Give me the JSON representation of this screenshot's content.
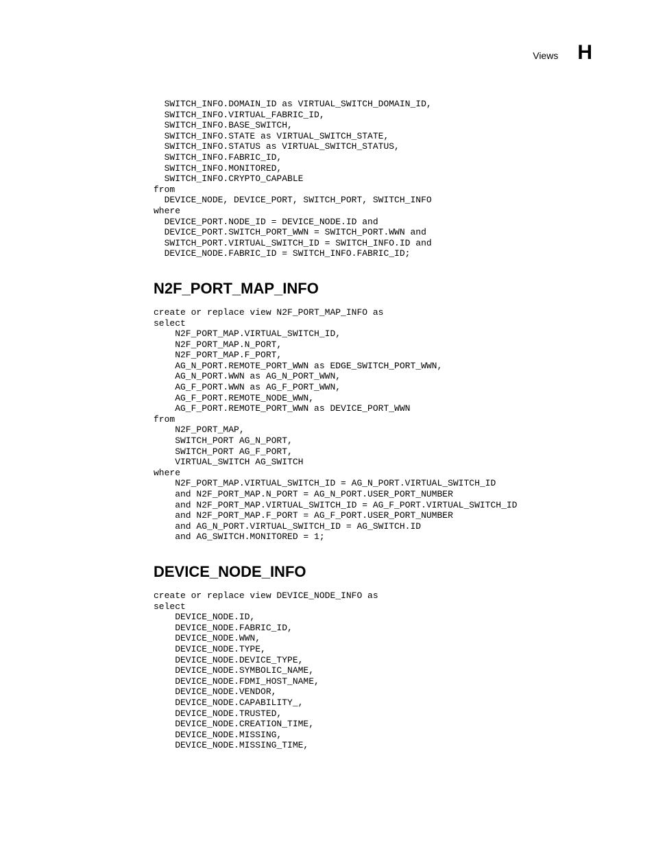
{
  "header": {
    "label": "Views",
    "letter": "H"
  },
  "code_block_1": "  SWITCH_INFO.DOMAIN_ID as VIRTUAL_SWITCH_DOMAIN_ID,\n  SWITCH_INFO.VIRTUAL_FABRIC_ID,\n  SWITCH_INFO.BASE_SWITCH,\n  SWITCH_INFO.STATE as VIRTUAL_SWITCH_STATE,\n  SWITCH_INFO.STATUS as VIRTUAL_SWITCH_STATUS,\n  SWITCH_INFO.FABRIC_ID,\n  SWITCH_INFO.MONITORED,\n  SWITCH_INFO.CRYPTO_CAPABLE\nfrom\n  DEVICE_NODE, DEVICE_PORT, SWITCH_PORT, SWITCH_INFO\nwhere\n  DEVICE_PORT.NODE_ID = DEVICE_NODE.ID and\n  DEVICE_PORT.SWITCH_PORT_WWN = SWITCH_PORT.WWN and\n  SWITCH_PORT.VIRTUAL_SWITCH_ID = SWITCH_INFO.ID and\n  DEVICE_NODE.FABRIC_ID = SWITCH_INFO.FABRIC_ID;",
  "heading_1": "N2F_PORT_MAP_INFO",
  "code_block_2": "create or replace view N2F_PORT_MAP_INFO as\nselect\n    N2F_PORT_MAP.VIRTUAL_SWITCH_ID,\n    N2F_PORT_MAP.N_PORT,\n    N2F_PORT_MAP.F_PORT,\n    AG_N_PORT.REMOTE_PORT_WWN as EDGE_SWITCH_PORT_WWN,\n    AG_N_PORT.WWN as AG_N_PORT_WWN,\n    AG_F_PORT.WWN as AG_F_PORT_WWN,\n    AG_F_PORT.REMOTE_NODE_WWN,\n    AG_F_PORT.REMOTE_PORT_WWN as DEVICE_PORT_WWN\nfrom\n    N2F_PORT_MAP,\n    SWITCH_PORT AG_N_PORT,\n    SWITCH_PORT AG_F_PORT,\n    VIRTUAL_SWITCH AG_SWITCH\nwhere\n    N2F_PORT_MAP.VIRTUAL_SWITCH_ID = AG_N_PORT.VIRTUAL_SWITCH_ID\n    and N2F_PORT_MAP.N_PORT = AG_N_PORT.USER_PORT_NUMBER\n    and N2F_PORT_MAP.VIRTUAL_SWITCH_ID = AG_F_PORT.VIRTUAL_SWITCH_ID\n    and N2F_PORT_MAP.F_PORT = AG_F_PORT.USER_PORT_NUMBER\n    and AG_N_PORT.VIRTUAL_SWITCH_ID = AG_SWITCH.ID\n    and AG_SWITCH.MONITORED = 1;",
  "heading_2": "DEVICE_NODE_INFO",
  "code_block_3": "create or replace view DEVICE_NODE_INFO as\nselect\n    DEVICE_NODE.ID,\n    DEVICE_NODE.FABRIC_ID,\n    DEVICE_NODE.WWN,\n    DEVICE_NODE.TYPE,\n    DEVICE_NODE.DEVICE_TYPE,\n    DEVICE_NODE.SYMBOLIC_NAME,\n    DEVICE_NODE.FDMI_HOST_NAME,\n    DEVICE_NODE.VENDOR,\n    DEVICE_NODE.CAPABILITY_,\n    DEVICE_NODE.TRUSTED,\n    DEVICE_NODE.CREATION_TIME,\n    DEVICE_NODE.MISSING,\n    DEVICE_NODE.MISSING_TIME,"
}
